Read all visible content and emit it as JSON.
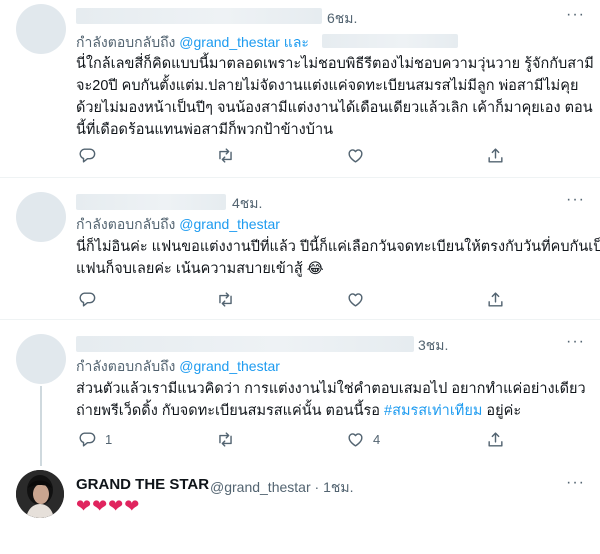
{
  "tweets": [
    {
      "time": "6ชม.",
      "more": "···",
      "reply_prefix": "กำลังตอบกลับถึง ",
      "reply_mention": "@grand_thestar",
      "reply_suffix": " และ",
      "lines": [
        "นี่ใกล้เลขสี่ก็คิดแบบนี้มาตลอดเพราะไม่ชอบพิธีรีตองไม่ชอบความวุ่นวาย รู้จักกับสามี",
        "จะ20ปี คบกันตั้งแต่ม.ปลายไม่จัดงานแต่งแค่จดทะเบียนสมรสไม่มีลูก พ่อสามีไม่คุย",
        "ด้วยไม่มองหน้าเป็นปีๆ จนน้องสามีแต่งงานได้เดือนเดียวแล้วเลิก เค้าก็มาคุยเอง ตอน",
        "นี้ที่เดือดร้อนแทนพ่อสามีก็พวกป้าข้างบ้าน"
      ]
    },
    {
      "time": "4ชม.",
      "more": "···",
      "reply_prefix": "กำลังตอบกลับถึง ",
      "reply_mention": "@grand_thestar",
      "lines": [
        "นี่ก็ไม่อินค่ะ แฟนขอแต่งงานปีที่แล้ว ปีนี้ก็แค่เลือกวันจดทะเบียนให้ตรงกับวันที่คบกันเป็น",
        "แฟนก็จบเลยค่ะ เน้นความสบายเข้าสู้ 😂"
      ]
    },
    {
      "time": "3ชม.",
      "more": "···",
      "reply_prefix": "กำลังตอบกลับถึง ",
      "reply_mention": "@grand_thestar",
      "lines_plain": [
        "ส่วนตัวแล้วเรามีแนวคิดว่า การแต่งงานไม่ใช่คำตอบเสมอไป อยากทำแค่อย่างเดียว"
      ],
      "line2_prefix": "ถ่ายพรีเว็ดดิ้ง กับจดทะเบียนสมรสแค่นั้น ตอนนี้รอ ",
      "hashtag": "#สมรสเท่าเทียม",
      "line2_suffix": " อยู่ค่ะ",
      "reply_count": "1",
      "like_count": "4"
    }
  ],
  "reply_tweet": {
    "name": "GRAND THE STAR",
    "handle": "@grand_thestar",
    "sep": "·",
    "time": "1ชม.",
    "hearts": "❤❤❤❤"
  },
  "colors": {
    "link": "#1d9bf0",
    "secondary": "#536471",
    "heart": "#e0245e",
    "thread_line": "#cfd9de"
  },
  "icons": [
    "reply-icon",
    "retweet-icon",
    "like-icon",
    "share-icon",
    "more-icon"
  ]
}
